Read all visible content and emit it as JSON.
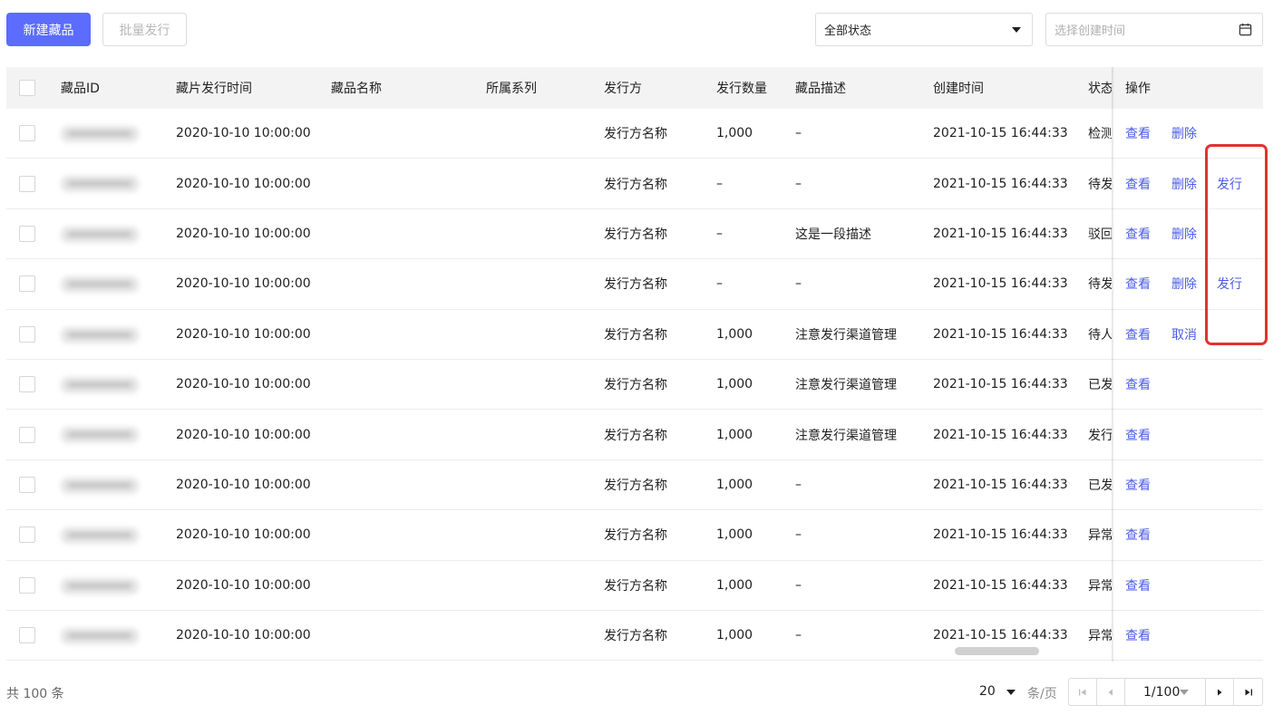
{
  "toolbar": {
    "create_label": "新建藏品",
    "batch_issue_label": "批量发行",
    "status_select_value": "全部状态",
    "created_time_placeholder": "选择创建时间"
  },
  "table": {
    "headers": {
      "id": "藏品ID",
      "issue_time": "藏片发行时间",
      "name": "藏品名称",
      "series": "所属系列",
      "issuer": "发行方",
      "quantity": "发行数量",
      "description": "藏品描述",
      "created_time": "创建时间",
      "status": "状态",
      "actions": "操作"
    },
    "rows": [
      {
        "issue_time": "2020-10-10 10:00:00",
        "issuer": "发行方名称",
        "quantity": "1,000",
        "description": "–",
        "created_time": "2021-10-15 16:44:33",
        "status": "检测",
        "action1": "查看",
        "action2": "删除",
        "action3": ""
      },
      {
        "issue_time": "2020-10-10 10:00:00",
        "issuer": "发行方名称",
        "quantity": "–",
        "description": "–",
        "created_time": "2021-10-15 16:44:33",
        "status": "待发",
        "action1": "查看",
        "action2": "删除",
        "action3": "发行"
      },
      {
        "issue_time": "2020-10-10 10:00:00",
        "issuer": "发行方名称",
        "quantity": "–",
        "description": "这是一段描述",
        "created_time": "2021-10-15 16:44:33",
        "status": "驳回",
        "action1": "查看",
        "action2": "删除",
        "action3": ""
      },
      {
        "issue_time": "2020-10-10 10:00:00",
        "issuer": "发行方名称",
        "quantity": "–",
        "description": "–",
        "created_time": "2021-10-15 16:44:33",
        "status": "待发",
        "action1": "查看",
        "action2": "删除",
        "action3": "发行"
      },
      {
        "issue_time": "2020-10-10 10:00:00",
        "issuer": "发行方名称",
        "quantity": "1,000",
        "description": "注意发行渠道管理",
        "created_time": "2021-10-15 16:44:33",
        "status": "待人",
        "action1": "查看",
        "action2": "取消",
        "action3": ""
      },
      {
        "issue_time": "2020-10-10 10:00:00",
        "issuer": "发行方名称",
        "quantity": "1,000",
        "description": "注意发行渠道管理",
        "created_time": "2021-10-15 16:44:33",
        "status": "已发",
        "action1": "查看",
        "action2": "",
        "action3": ""
      },
      {
        "issue_time": "2020-10-10 10:00:00",
        "issuer": "发行方名称",
        "quantity": "1,000",
        "description": "注意发行渠道管理",
        "created_time": "2021-10-15 16:44:33",
        "status": "发行",
        "action1": "查看",
        "action2": "",
        "action3": ""
      },
      {
        "issue_time": "2020-10-10 10:00:00",
        "issuer": "发行方名称",
        "quantity": "1,000",
        "description": "–",
        "created_time": "2021-10-15 16:44:33",
        "status": "已发",
        "action1": "查看",
        "action2": "",
        "action3": ""
      },
      {
        "issue_time": "2020-10-10 10:00:00",
        "issuer": "发行方名称",
        "quantity": "1,000",
        "description": "–",
        "created_time": "2021-10-15 16:44:33",
        "status": "异常",
        "action1": "查看",
        "action2": "",
        "action3": ""
      },
      {
        "issue_time": "2020-10-10 10:00:00",
        "issuer": "发行方名称",
        "quantity": "1,000",
        "description": "–",
        "created_time": "2021-10-15 16:44:33",
        "status": "异常",
        "action1": "查看",
        "action2": "",
        "action3": ""
      },
      {
        "issue_time": "2020-10-10 10:00:00",
        "issuer": "发行方名称",
        "quantity": "1,000",
        "description": "–",
        "created_time": "2021-10-15 16:44:33",
        "status": "异常",
        "action1": "查看",
        "action2": "",
        "action3": ""
      }
    ]
  },
  "footer": {
    "total": "共 100 条",
    "page_size": "20",
    "per_page": "条/页",
    "page_indicator": "1/100"
  },
  "colors": {
    "primary": "#5b6cff",
    "link": "#4b5ce6",
    "highlight_border": "#e0332f"
  },
  "icons": {
    "status_dropdown": "caret-down-icon",
    "date_picker": "calendar-icon",
    "first_page": "first-page-icon",
    "prev_page": "prev-page-icon",
    "next_page": "next-page-icon",
    "last_page": "last-page-icon"
  }
}
